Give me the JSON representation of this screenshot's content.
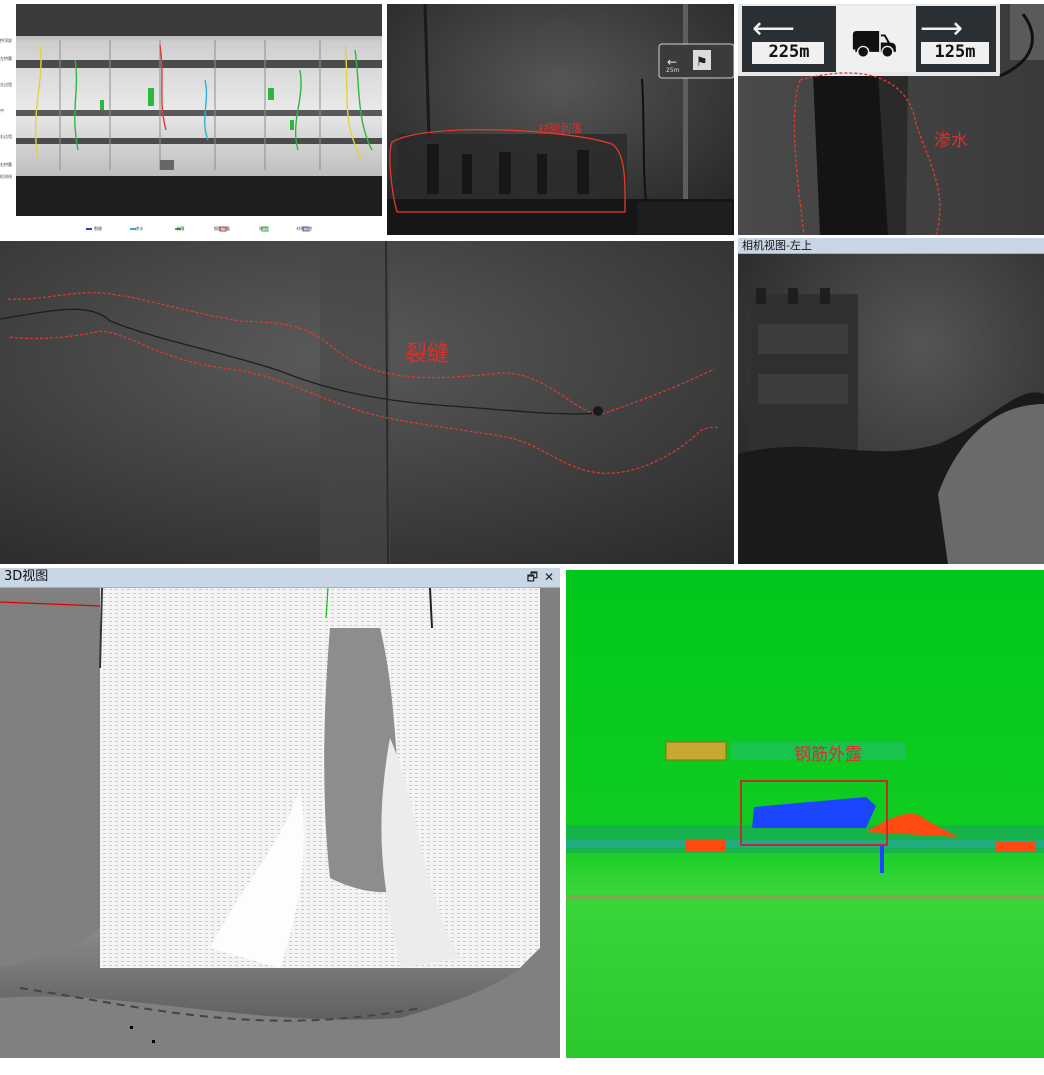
{
  "colors": {
    "annotation_red": "#e33a2f",
    "titlebar_bg": "#c9d6e6",
    "heatmap_green": "#05c91d",
    "heatmap_blue": "#1b45ff",
    "heatmap_orange": "#ff4a12"
  },
  "panel_scan": {
    "row_labels": [
      "拱顶部",
      "左拱腰",
      "左边墙",
      "中",
      "右边墙",
      "右拱腰",
      "检测线"
    ],
    "legend": [
      "裂缝",
      "渗水",
      "剥落",
      "钢筋外露",
      "掉块",
      "衬砌脱空"
    ]
  },
  "panel_spalling": {
    "label": "衬砌剥落",
    "sign_numbers": [
      "25m"
    ]
  },
  "panel_seepage": {
    "label": "渗水",
    "sign_left": "225m",
    "sign_right": "125m"
  },
  "panel_crack": {
    "label": "裂缝"
  },
  "panel_camera": {
    "title": "相机视图-左上"
  },
  "panel_3d": {
    "title": "3D视图",
    "restore_icon": "restore-icon",
    "close_icon": "close-icon",
    "close_glyph": "✕",
    "restore_glyph": "🗗"
  },
  "panel_heatmap": {
    "label": "钢筋外露"
  }
}
